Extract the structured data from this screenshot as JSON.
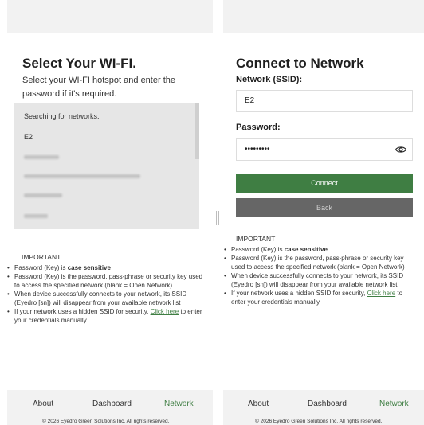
{
  "wifi_panel": {
    "title": "Select Your WI-FI.",
    "subtitle_line1": "Select your WI-FI hotspot and enter the",
    "subtitle_line2": "password if it's required.",
    "searching_text": "Searching for networks.",
    "networks": [
      {
        "ssid": "E2",
        "blurred": false
      },
      {
        "ssid": "",
        "blurred": true
      },
      {
        "ssid": "",
        "blurred": true
      },
      {
        "ssid": "",
        "blurred": true
      },
      {
        "ssid": "",
        "blurred": true
      }
    ]
  },
  "connect_panel": {
    "title": "Connect to Network",
    "ssid_label": "Network (SSID):",
    "ssid_value": "E2",
    "password_label": "Password:",
    "password_value": "•••••••••",
    "connect_label": "Connect",
    "back_label": "Back",
    "eye_icon": "eye-icon"
  },
  "important": {
    "heading": "IMPORTANT",
    "b1_pre": "Password (Key) is ",
    "b1_bold": "case sensitive",
    "b2": "Password (Key) is the password, pass-phrase or security key used to access the specified network (blank = Open Network)",
    "b3": "When device successfully connects to your network, its SSID (Eyedro [sn]) will disappear from your available network list",
    "b4_pre": "If your network uses a hidden SSID for security, ",
    "b4_link": "Click here",
    "b4_post": " to enter your credentials manually"
  },
  "nav": {
    "about": "About",
    "dashboard": "Dashboard",
    "network": "Network"
  },
  "footer": {
    "copyright": "© 2026 Eyedro Green Solutions Inc. All rights reserved."
  },
  "colors": {
    "accent": "#3f7e43",
    "back_button": "#666666"
  }
}
